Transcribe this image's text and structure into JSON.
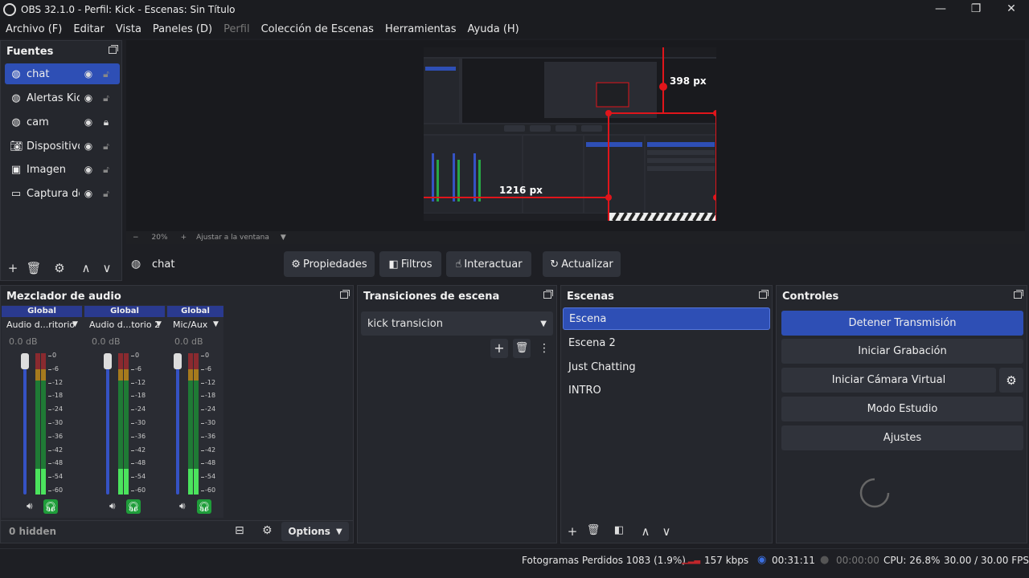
{
  "window": {
    "title": "OBS 32.1.0 - Perfil: Kick - Escenas: Sin Título",
    "minimize": "—",
    "maximize": "❐",
    "close": "✕"
  },
  "menu": [
    "Archivo (F)",
    "Editar",
    "Vista",
    "Paneles (D)",
    "Perfil",
    "Colección de Escenas",
    "Herramientas",
    "Ayuda (H)"
  ],
  "sources": {
    "title": "Fuentes",
    "items": [
      {
        "label": "chat",
        "icon": "globe-icon",
        "locked": false,
        "selected": true
      },
      {
        "label": "Alertas Kick",
        "icon": "globe-icon",
        "locked": false
      },
      {
        "label": "cam",
        "icon": "globe-icon",
        "locked": true
      },
      {
        "label": "Dispositivo",
        "icon": "camera-icon",
        "locked": false
      },
      {
        "label": "Imagen",
        "icon": "image-icon",
        "locked": false
      },
      {
        "label": "Captura de",
        "icon": "monitor-icon",
        "locked": false
      }
    ]
  },
  "preview": {
    "measure_vertical": "398 px",
    "measure_horizontal": "1216 px",
    "zoom_minus": "−",
    "zoom": "20%",
    "zoom_plus": "+",
    "fit_label": "Ajustar a la ventana"
  },
  "context": {
    "source_name": "chat",
    "buttons": [
      "Propiedades",
      "Filtros",
      "Interactuar",
      "Actualizar"
    ]
  },
  "mixer": {
    "title": "Mezclador de audio",
    "channels": [
      {
        "head": "Global",
        "name": "Audio d...ritorio",
        "db": "0.0 dB"
      },
      {
        "head": "Global",
        "name": "Audio d...torio 2",
        "db": "0.0 dB"
      },
      {
        "head": "Global",
        "name": "Mic/Aux",
        "db": "0.0 dB"
      }
    ],
    "scale": [
      "0",
      "-6",
      "-12",
      "-18",
      "-24",
      "-30",
      "-36",
      "-42",
      "-48",
      "-54",
      "-60"
    ],
    "hidden": "0 hidden",
    "options": "Options"
  },
  "transitions": {
    "title": "Transiciones de escena",
    "selected": "kick transicion"
  },
  "scenes": {
    "title": "Escenas",
    "items": [
      "Escena",
      "Escena 2",
      "Just Chatting",
      "INTRO"
    ]
  },
  "controls": {
    "title": "Controles",
    "stream": "Detener Transmisión",
    "record": "Iniciar Grabación",
    "virtualcam": "Iniciar Cámara Virtual",
    "studio": "Modo Estudio",
    "settings": "Ajustes"
  },
  "status": {
    "dropped": "Fotogramas Perdidos 1083 (1.9%)",
    "bitrate": "157 kbps",
    "stream_time": "00:31:11",
    "rec_time": "00:00:00",
    "cpu": "CPU: 26.8%",
    "fps": "30.00 / 30.00 FPS"
  },
  "colors": {
    "accent": "#2e4fb5",
    "guide": "#e0151b",
    "meter_green": "#27a745"
  }
}
